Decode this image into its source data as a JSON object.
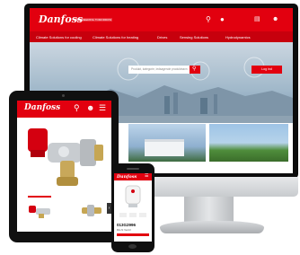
{
  "brand": {
    "logo_text": "Danfoss",
    "red": "#e2000f",
    "tagline": "ENGINEERING TOMORROW"
  },
  "desktop": {
    "nav_items": [
      "Climate Solutions for cooling",
      "Climate Solutions for heating",
      "Drives",
      "Sensing Solutions",
      "Hydrodynamics"
    ],
    "search_placeholder": "Produkt, kategorie, ledsagende produktnavn",
    "login_label": "Log ind",
    "header_icons": [
      "search-icon",
      "globe-icon",
      "cart-icon",
      "user-icon"
    ]
  },
  "tablet": {
    "header_icons": [
      "search-icon",
      "user-icon",
      "menu-icon"
    ],
    "product": "radiator thermostatic valve",
    "thumbnails": 2
  },
  "phone": {
    "product_code": "013G2996",
    "product_caption": "RA-N Ventil"
  }
}
